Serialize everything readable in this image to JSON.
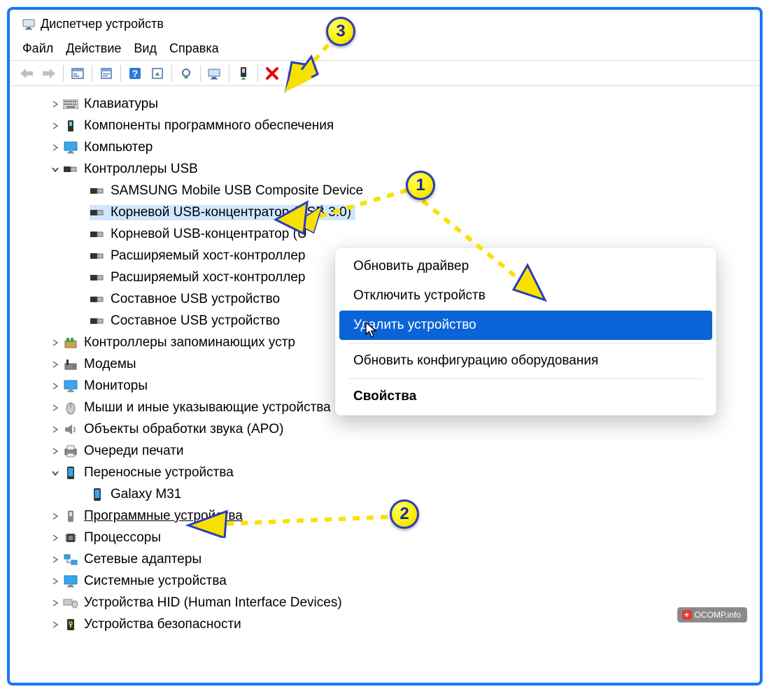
{
  "window": {
    "title": "Диспетчер устройств"
  },
  "menu": {
    "file": "Файл",
    "action": "Действие",
    "view": "Вид",
    "help": "Справка"
  },
  "tree": {
    "keyboards": "Клавиатуры",
    "software_components": "Компоненты программного обеспечения",
    "computer": "Компьютер",
    "usb_controllers": "Контроллеры USB",
    "usb_children": {
      "samsung": "SAMSUNG Mobile USB Composite Device",
      "root_hub_30": "Корневой USB-концентратор (USB 3.0)",
      "root_hub_u": "Корневой USB-концентратор (U",
      "xhci1": "Расширяемый хост-контроллер",
      "xhci2": "Расширяемый хост-контроллер",
      "composite1": "Составное USB устройство",
      "composite2": "Составное USB устройство"
    },
    "storage_controllers": "Контроллеры запоминающих устр",
    "modems": "Модемы",
    "monitors": "Мониторы",
    "mice": "Мыши и иные указывающие устройства",
    "apo": "Объекты обработки звука (APO)",
    "print_queues": "Очереди печати",
    "portable": "Переносные устройства",
    "portable_child": "Galaxy M31",
    "software_devices": "Программные устройства",
    "processors": "Процессоры",
    "network": "Сетевые адаптеры",
    "system": "Системные устройства",
    "hid": "Устройства HID (Human Interface Devices)",
    "security": "Устройства безопасности"
  },
  "context_menu": {
    "update_driver": "Обновить драйвер",
    "disable": "Отключить устройств",
    "uninstall": "Удалить устройство",
    "scan": "Обновить конфигурацию оборудования",
    "properties": "Свойства"
  },
  "callouts": {
    "b1": "1",
    "b2": "2",
    "b3": "3"
  },
  "watermark": {
    "text": "OCOMP.info"
  }
}
